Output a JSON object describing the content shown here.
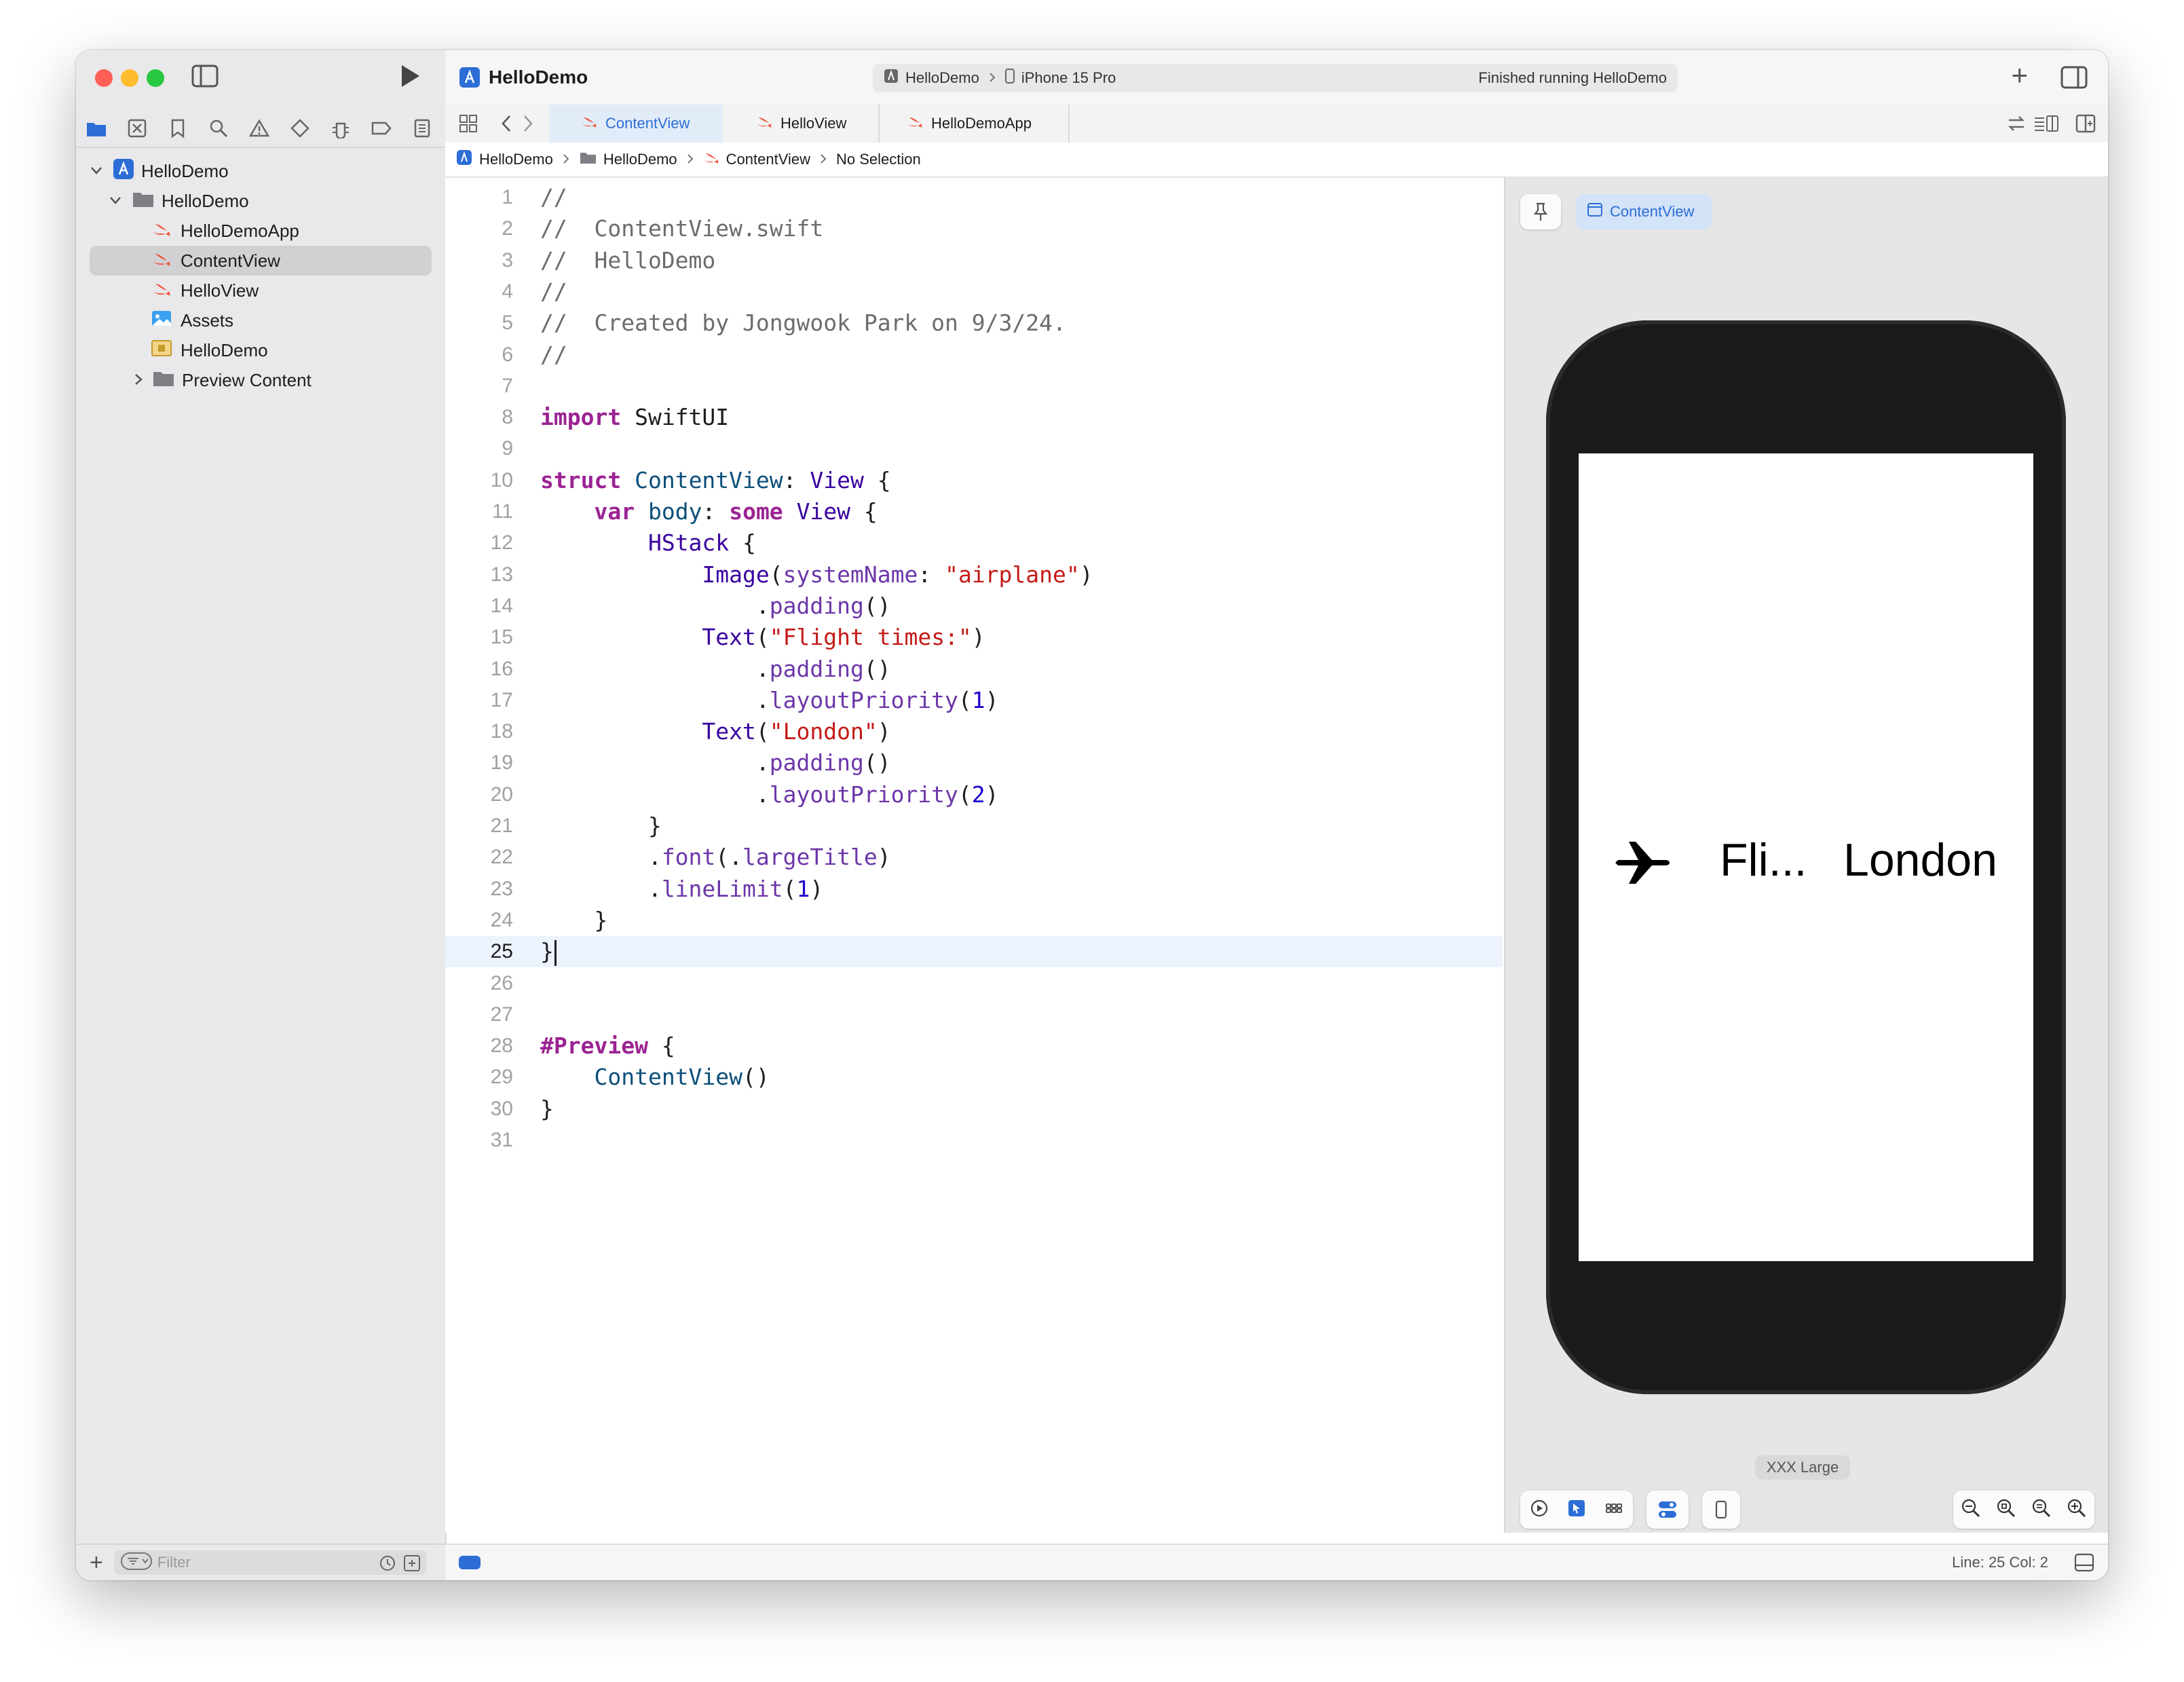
{
  "project_name": "HelloDemo",
  "scheme": {
    "target": "HelloDemo",
    "device": "iPhone 15 Pro"
  },
  "status_message": "Finished running HelloDemo",
  "tabs": [
    "ContentView",
    "HelloView",
    "HelloDemoApp"
  ],
  "active_tab": "ContentView",
  "breadcrumb": [
    "HelloDemo",
    "HelloDemo",
    "ContentView",
    "No Selection"
  ],
  "sidebar": {
    "tree": [
      {
        "label": "HelloDemo",
        "kind": "project"
      },
      {
        "label": "HelloDemo",
        "kind": "folder"
      },
      {
        "label": "HelloDemoApp",
        "kind": "swift"
      },
      {
        "label": "ContentView",
        "kind": "swift"
      },
      {
        "label": "HelloView",
        "kind": "swift"
      },
      {
        "label": "Assets",
        "kind": "assets"
      },
      {
        "label": "HelloDemo",
        "kind": "entitlements"
      },
      {
        "label": "Preview Content",
        "kind": "folder"
      }
    ],
    "selected": "ContentView",
    "filter_placeholder": "Filter"
  },
  "code": {
    "line_numbers": [
      "1",
      "2",
      "3",
      "4",
      "5",
      "6",
      "7",
      "8",
      "9",
      "10",
      "11",
      "12",
      "13",
      "14",
      "15",
      "16",
      "17",
      "18",
      "19",
      "20",
      "21",
      "22",
      "23",
      "24",
      "25",
      "26",
      "27",
      "28",
      "29",
      "30",
      "31"
    ],
    "current_line": "25",
    "lines": [
      [
        [
          "//",
          "cm"
        ]
      ],
      [
        [
          "//  ContentView.swift",
          "cm"
        ]
      ],
      [
        [
          "//  HelloDemo",
          "cm"
        ]
      ],
      [
        [
          "//",
          "cm"
        ]
      ],
      [
        [
          "//  Created by Jongwook Park on 9/3/24.",
          "cm"
        ]
      ],
      [
        [
          "//",
          "cm"
        ]
      ],
      [],
      [
        [
          "import",
          "kw"
        ],
        [
          " SwiftUI",
          "pl"
        ]
      ],
      [],
      [
        [
          "struct",
          "kw"
        ],
        [
          " ",
          "pl"
        ],
        [
          "ContentView",
          "ty"
        ],
        [
          ": ",
          "pl"
        ],
        [
          "View",
          "ty2"
        ],
        [
          " {",
          "pl"
        ]
      ],
      [
        [
          "    ",
          "pl"
        ],
        [
          "var",
          "kw"
        ],
        [
          " ",
          "pl"
        ],
        [
          "body",
          "ty"
        ],
        [
          ": ",
          "pl"
        ],
        [
          "some",
          "kw"
        ],
        [
          " ",
          "pl"
        ],
        [
          "View",
          "ty2"
        ],
        [
          " {",
          "pl"
        ]
      ],
      [
        [
          "        ",
          "pl"
        ],
        [
          "HStack",
          "ty2"
        ],
        [
          " {",
          "pl"
        ]
      ],
      [
        [
          "            ",
          "pl"
        ],
        [
          "Image",
          "ty2"
        ],
        [
          "(",
          "pl"
        ],
        [
          "systemName",
          "fn"
        ],
        [
          ": ",
          "pl"
        ],
        [
          "\"airplane\"",
          "str"
        ],
        [
          ")",
          "pl"
        ]
      ],
      [
        [
          "                .",
          "pl"
        ],
        [
          "padding",
          "fn"
        ],
        [
          "()",
          "pl"
        ]
      ],
      [
        [
          "            ",
          "pl"
        ],
        [
          "Text",
          "ty2"
        ],
        [
          "(",
          "pl"
        ],
        [
          "\"Flight times:\"",
          "str"
        ],
        [
          ")",
          "pl"
        ]
      ],
      [
        [
          "                .",
          "pl"
        ],
        [
          "padding",
          "fn"
        ],
        [
          "()",
          "pl"
        ]
      ],
      [
        [
          "                .",
          "pl"
        ],
        [
          "layoutPriority",
          "fn"
        ],
        [
          "(",
          "pl"
        ],
        [
          "1",
          "num"
        ],
        [
          ")",
          "pl"
        ]
      ],
      [
        [
          "            ",
          "pl"
        ],
        [
          "Text",
          "ty2"
        ],
        [
          "(",
          "pl"
        ],
        [
          "\"London\"",
          "str"
        ],
        [
          ")",
          "pl"
        ]
      ],
      [
        [
          "                .",
          "pl"
        ],
        [
          "padding",
          "fn"
        ],
        [
          "()",
          "pl"
        ]
      ],
      [
        [
          "                .",
          "pl"
        ],
        [
          "layoutPriority",
          "fn"
        ],
        [
          "(",
          "pl"
        ],
        [
          "2",
          "num"
        ],
        [
          ")",
          "pl"
        ]
      ],
      [
        [
          "        }",
          "pl"
        ]
      ],
      [
        [
          "        .",
          "pl"
        ],
        [
          "font",
          "fn"
        ],
        [
          "(.",
          "pl"
        ],
        [
          "largeTitle",
          "fn"
        ],
        [
          ")",
          "pl"
        ]
      ],
      [
        [
          "        .",
          "pl"
        ],
        [
          "lineLimit",
          "fn"
        ],
        [
          "(",
          "pl"
        ],
        [
          "1",
          "num"
        ],
        [
          ")",
          "pl"
        ]
      ],
      [
        [
          "    }",
          "pl"
        ]
      ],
      [
        [
          "}",
          "pl"
        ]
      ],
      [],
      [],
      [
        [
          "#Preview",
          "kw"
        ],
        [
          " {",
          "pl"
        ]
      ],
      [
        [
          "    ",
          "pl"
        ],
        [
          "ContentView",
          "ty"
        ],
        [
          "()",
          "pl"
        ]
      ],
      [
        [
          "}",
          "pl"
        ]
      ],
      []
    ]
  },
  "preview": {
    "pill_label": "ContentView",
    "text_truncated": "Fli...",
    "text_city": "London",
    "dynamic_type_label": "XXX Large"
  },
  "cursor": {
    "line_col": "Line: 25  Col: 2"
  },
  "colors": {
    "accent": "#2c6ed6",
    "swift_orange": "#f05138",
    "close": "#ff5f57",
    "minimize": "#febc2e",
    "zoom": "#28c840"
  }
}
